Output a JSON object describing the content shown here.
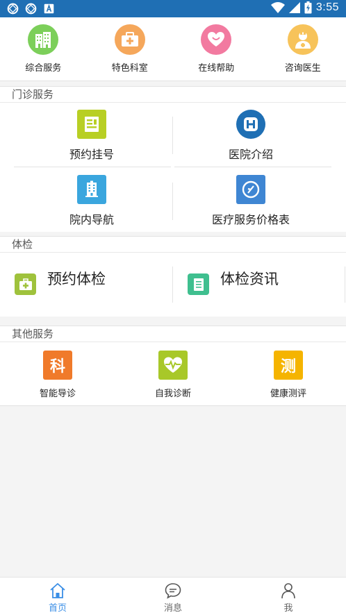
{
  "status_bar": {
    "time": "3:55",
    "left_icons": [
      "sync-icon",
      "sync-icon",
      "keyboard-icon"
    ],
    "right_icons": [
      "wifi-icon",
      "signal-icon",
      "battery-icon"
    ]
  },
  "top_grid": [
    {
      "label": "综合服务",
      "icon": "building-icon",
      "color": "#7ccf5a"
    },
    {
      "label": "特色科室",
      "icon": "medical-kit-icon",
      "color": "#f5a75b"
    },
    {
      "label": "在线帮助",
      "icon": "heart-icon",
      "color": "#f27aa0"
    },
    {
      "label": "咨询医生",
      "icon": "doctor-icon",
      "color": "#f7c35a"
    }
  ],
  "sections": {
    "outpatient": {
      "title": "门诊服务",
      "items": [
        {
          "label": "预约挂号",
          "icon": "register-card-icon",
          "color": "#b8cf24"
        },
        {
          "label": "医院介绍",
          "icon": "hospital-h-icon",
          "color": "#1f6fb4"
        },
        {
          "label": "院内导航",
          "icon": "building-nav-icon",
          "color": "#3aa6de"
        },
        {
          "label": "医疗服务价格表",
          "icon": "price-clock-icon",
          "color": "#3f86d3"
        }
      ]
    },
    "checkup": {
      "title": "体检",
      "items": [
        {
          "label": "预约体检",
          "icon": "kit-icon",
          "color": "#9fc23c"
        },
        {
          "label": "体检资讯",
          "icon": "document-icon",
          "color": "#3fbf8f"
        }
      ]
    },
    "other": {
      "title": "其他服务",
      "items": [
        {
          "label": "智能导诊",
          "icon": "ke-badge-icon",
          "glyph": "科",
          "color": "#f07a2a"
        },
        {
          "label": "自我诊断",
          "icon": "heartbeat-icon",
          "color": "#a8c829"
        },
        {
          "label": "健康测评",
          "icon": "ce-badge-icon",
          "glyph": "测",
          "color": "#f5b400"
        }
      ]
    }
  },
  "bottom_nav": [
    {
      "label": "首页",
      "icon": "home-icon",
      "active": true
    },
    {
      "label": "消息",
      "icon": "message-icon",
      "active": false
    },
    {
      "label": "我",
      "icon": "user-icon",
      "active": false
    }
  ],
  "colors": {
    "status_bar": "#1f6fb4",
    "accent": "#3a8ee6"
  }
}
